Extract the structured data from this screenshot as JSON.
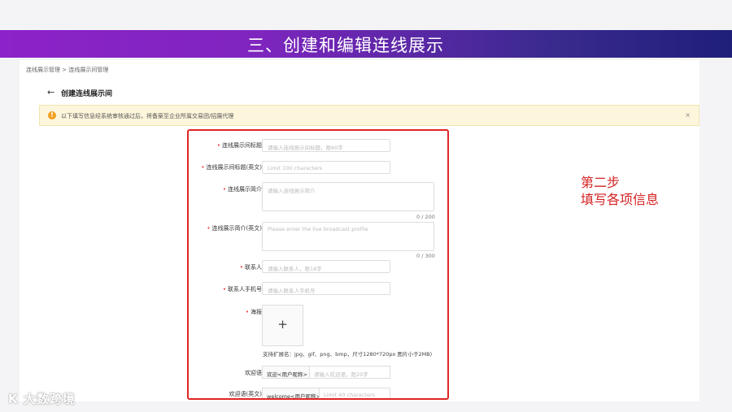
{
  "banner": {
    "title": "三、创建和编辑连线展示"
  },
  "breadcrumb": "连线展示管理 > 连线展示间管理",
  "page": {
    "title": "创建连线展示间",
    "back_icon": "arrow-left-icon"
  },
  "notice": {
    "text": "以下填写信息经系统审核通过后，将备案至企业所属交易团/招展代理",
    "icon": "warning-circle-icon",
    "close": "×",
    "color": "#f0a020"
  },
  "form": {
    "fields": [
      {
        "label": "连线展示间标题",
        "required": true,
        "placeholder": "请输入连线展示间标题，限60字"
      },
      {
        "label": "连线展示间标题(英文)",
        "required": true,
        "placeholder": "Limit 100 characters"
      },
      {
        "label": "连线展示简介",
        "required": true,
        "placeholder": "请输入连线展示简介",
        "counter": "0 / 200"
      },
      {
        "label": "连线展示简介(英文)",
        "required": true,
        "placeholder": "Please enter the live broadcast profile",
        "counter": "0 / 300"
      },
      {
        "label": "联系人",
        "required": true,
        "placeholder": "请输入联系人，限18字"
      },
      {
        "label": "联系人手机号",
        "required": true,
        "placeholder": "请输入联系人手机号"
      }
    ],
    "poster": {
      "label": "海报",
      "required": true,
      "plus": "+",
      "hint": "支持扩展名：jpg、gif、png、bmp，尺寸1280*720px 图片小于2MB)"
    },
    "welcome": {
      "label": "欢迎语",
      "prefix": "欢迎<用户昵称>",
      "placeholder": "请输入欢迎语，限20字"
    },
    "welcome_en": {
      "label": "欢迎语(英文)",
      "prefix": "welcome<用户昵称>",
      "placeholder": "Limit 40 characters"
    }
  },
  "annotation": {
    "line1": "第二步",
    "line2": "填写各项信息",
    "color": "#d42222"
  },
  "logo": {
    "text": "大数跨境",
    "mark": "K"
  }
}
